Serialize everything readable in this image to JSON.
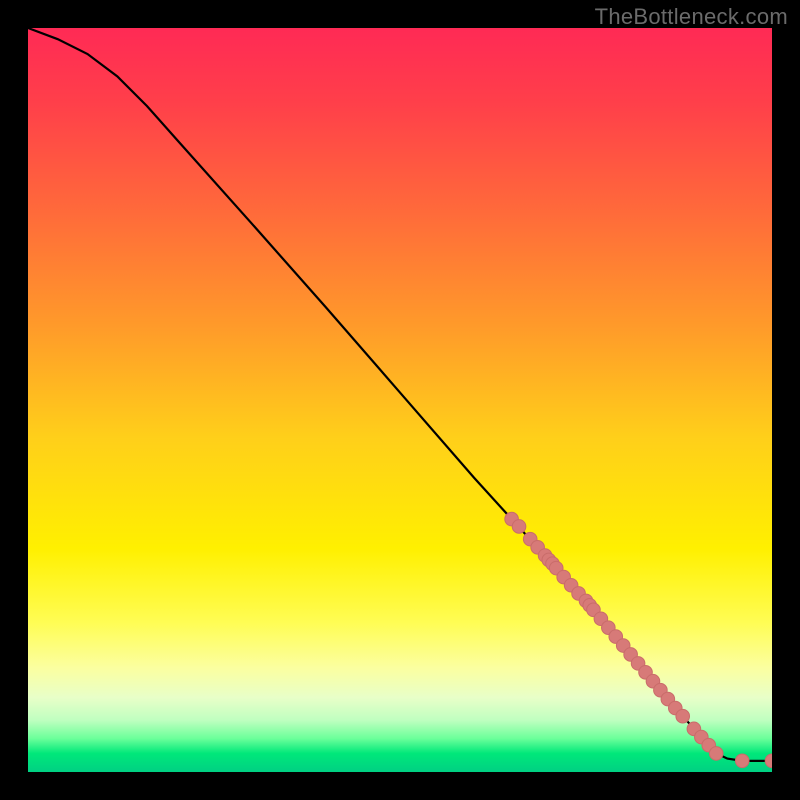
{
  "attribution": "TheBottleneck.com",
  "chart_data": {
    "type": "line",
    "title": "",
    "xlabel": "",
    "ylabel": "",
    "xlim": [
      0,
      100
    ],
    "ylim": [
      0,
      100
    ],
    "series": [
      {
        "name": "curve",
        "x": [
          0,
          4,
          8,
          12,
          16,
          20,
          30,
          40,
          50,
          60,
          65,
          70,
          75,
          80,
          85,
          88,
          92.5,
          94,
          96,
          98,
          100
        ],
        "y": [
          100,
          98.5,
          96.5,
          93.5,
          89.5,
          85,
          73.8,
          62.5,
          51,
          39.5,
          34,
          28.5,
          23,
          17,
          11,
          7.5,
          2.5,
          1.8,
          1.5,
          1.5,
          1.5
        ]
      }
    ],
    "highlight_points": {
      "name": "dotted-segment",
      "x": [
        65,
        66,
        67.5,
        68.5,
        69.5,
        70,
        70.5,
        71,
        72,
        73,
        74,
        75,
        75.5,
        76,
        77,
        78,
        79,
        80,
        81,
        82,
        83,
        84,
        85,
        86,
        87,
        88,
        89.5,
        90.5,
        91.5,
        92.5,
        96,
        100
      ],
      "y": [
        34,
        33,
        31.3,
        30.2,
        29.1,
        28.5,
        28,
        27.4,
        26.2,
        25.1,
        24,
        23,
        22.4,
        21.8,
        20.6,
        19.4,
        18.2,
        17,
        15.8,
        14.6,
        13.4,
        12.2,
        11,
        9.8,
        8.6,
        7.5,
        5.8,
        4.7,
        3.6,
        2.5,
        1.5,
        1.5
      ]
    },
    "gradient_stops": [
      {
        "offset": 0.0,
        "color": "#ff2a55"
      },
      {
        "offset": 0.1,
        "color": "#ff3f4a"
      },
      {
        "offset": 0.25,
        "color": "#ff6b3a"
      },
      {
        "offset": 0.4,
        "color": "#ff9a2a"
      },
      {
        "offset": 0.55,
        "color": "#ffcf1a"
      },
      {
        "offset": 0.7,
        "color": "#fff000"
      },
      {
        "offset": 0.8,
        "color": "#fffd55"
      },
      {
        "offset": 0.86,
        "color": "#fbffa0"
      },
      {
        "offset": 0.9,
        "color": "#e8ffc8"
      },
      {
        "offset": 0.93,
        "color": "#c0ffc0"
      },
      {
        "offset": 0.955,
        "color": "#6bff9a"
      },
      {
        "offset": 0.975,
        "color": "#00e87a"
      },
      {
        "offset": 1.0,
        "color": "#00d083"
      }
    ],
    "colors": {
      "curve": "#000000",
      "dot_fill": "#d77a78",
      "dot_stroke": "#c96c6a"
    }
  }
}
